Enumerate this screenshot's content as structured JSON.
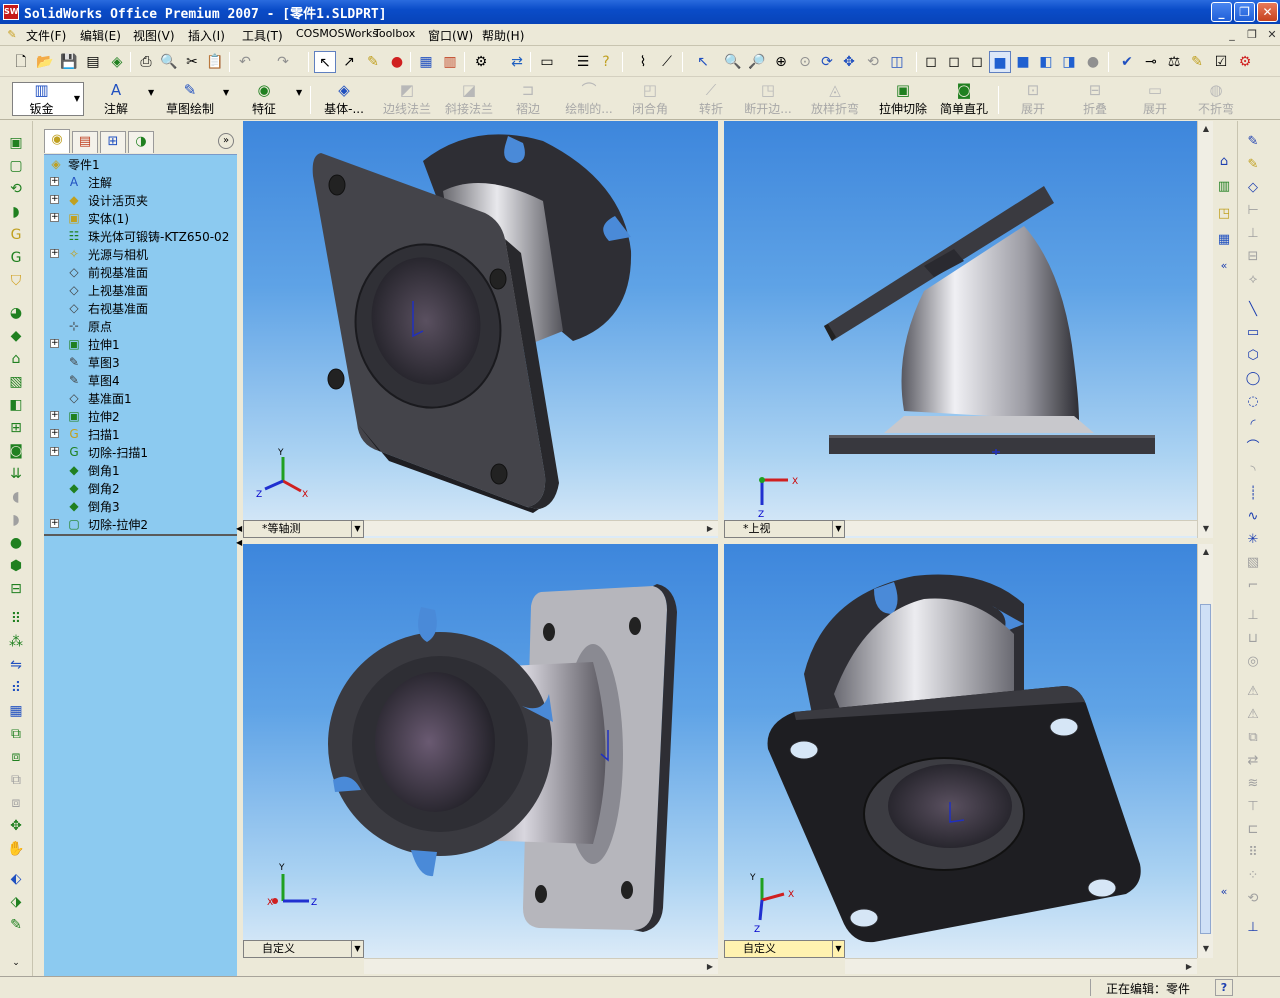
{
  "window": {
    "title": "SolidWorks Office Premium 2007 - [零件1.SLDPRT]",
    "app_icon": "SW"
  },
  "menu": [
    "文件(F)",
    "编辑(E)",
    "视图(V)",
    "插入(I)",
    "工具(T)",
    "COSMOSWorks",
    "Toolbox",
    "窗口(W)",
    "帮助(H)"
  ],
  "command_manager": {
    "buttons": [
      {
        "label": "钣金",
        "icon": "sheet-metal-icon",
        "enabled": true
      },
      {
        "label": "注解",
        "icon": "annotation-icon",
        "enabled": true
      },
      {
        "label": "草图绘制",
        "icon": "sketch-icon",
        "enabled": true
      },
      {
        "label": "特征",
        "icon": "features-icon",
        "enabled": true
      },
      {
        "label": "基体-...",
        "icon": "base-flange-icon",
        "enabled": true
      },
      {
        "label": "边线法兰",
        "icon": "edge-flange-icon",
        "enabled": false
      },
      {
        "label": "斜接法兰",
        "icon": "miter-flange-icon",
        "enabled": false
      },
      {
        "label": "褶边",
        "icon": "hem-icon",
        "enabled": false
      },
      {
        "label": "绘制的...",
        "icon": "sketched-bend-icon",
        "enabled": false
      },
      {
        "label": "闭合角",
        "icon": "closed-corner-icon",
        "enabled": false
      },
      {
        "label": "转折",
        "icon": "jog-icon",
        "enabled": false
      },
      {
        "label": "断开边...",
        "icon": "break-corner-icon",
        "enabled": false
      },
      {
        "label": "放样折弯",
        "icon": "lofted-bend-icon",
        "enabled": false
      },
      {
        "label": "拉伸切除",
        "icon": "extruded-cut-icon",
        "enabled": true
      },
      {
        "label": "简单直孔",
        "icon": "simple-hole-icon",
        "enabled": true
      },
      {
        "label": "展开",
        "icon": "unfold-icon",
        "enabled": false
      },
      {
        "label": "折叠",
        "icon": "fold-icon",
        "enabled": false
      },
      {
        "label": "展开",
        "icon": "flatten-icon",
        "enabled": false
      },
      {
        "label": "不折弯",
        "icon": "no-bends-icon",
        "enabled": false
      }
    ]
  },
  "feature_tree": {
    "root": "零件1",
    "items": [
      {
        "label": "注解",
        "icon": "annotation-folder-icon",
        "expandable": true
      },
      {
        "label": "设计活页夹",
        "icon": "design-binder-icon",
        "expandable": true
      },
      {
        "label": "实体(1)",
        "icon": "solid-bodies-icon",
        "expandable": true
      },
      {
        "label": "珠光体可锻铸-KTZ650-02",
        "icon": "material-icon",
        "expandable": false
      },
      {
        "label": "光源与相机",
        "icon": "lights-cameras-icon",
        "expandable": true
      },
      {
        "label": "前视基准面",
        "icon": "plane-icon",
        "expandable": false
      },
      {
        "label": "上视基准面",
        "icon": "plane-icon",
        "expandable": false
      },
      {
        "label": "右视基准面",
        "icon": "plane-icon",
        "expandable": false
      },
      {
        "label": "原点",
        "icon": "origin-icon",
        "expandable": false
      },
      {
        "label": "拉伸1",
        "icon": "extrude-icon",
        "expandable": true
      },
      {
        "label": "草图3",
        "icon": "sketch-icon",
        "expandable": false
      },
      {
        "label": "草图4",
        "icon": "sketch-icon",
        "expandable": false
      },
      {
        "label": "基准面1",
        "icon": "plane-icon",
        "expandable": false
      },
      {
        "label": "拉伸2",
        "icon": "extrude-icon",
        "expandable": true
      },
      {
        "label": "扫描1",
        "icon": "sweep-icon",
        "expandable": true
      },
      {
        "label": "切除-扫描1",
        "icon": "cut-sweep-icon",
        "expandable": true
      },
      {
        "label": "倒角1",
        "icon": "chamfer-icon",
        "expandable": false
      },
      {
        "label": "倒角2",
        "icon": "chamfer-icon",
        "expandable": false
      },
      {
        "label": "倒角3",
        "icon": "chamfer-icon",
        "expandable": false
      },
      {
        "label": "切除-拉伸2",
        "icon": "cut-extrude-icon",
        "expandable": true
      }
    ]
  },
  "viewports": [
    {
      "label": "*等轴测",
      "active": false
    },
    {
      "label": "*上视",
      "active": false
    },
    {
      "label": "自定义",
      "active": false
    },
    {
      "label": "自定义",
      "active": true
    }
  ],
  "triad": {
    "x": "X",
    "y": "Y",
    "z": "Z"
  },
  "status": {
    "text": "正在编辑：零件",
    "help": "?"
  },
  "colors": {
    "titlebar": "#0a4cc8",
    "viewport_top": "#3d86dc",
    "viewport_bottom": "#dcebf8",
    "tree_bg": "#8ccaf0",
    "part_dark": "#3a3a3e",
    "part_light": "#c8c8cc"
  }
}
